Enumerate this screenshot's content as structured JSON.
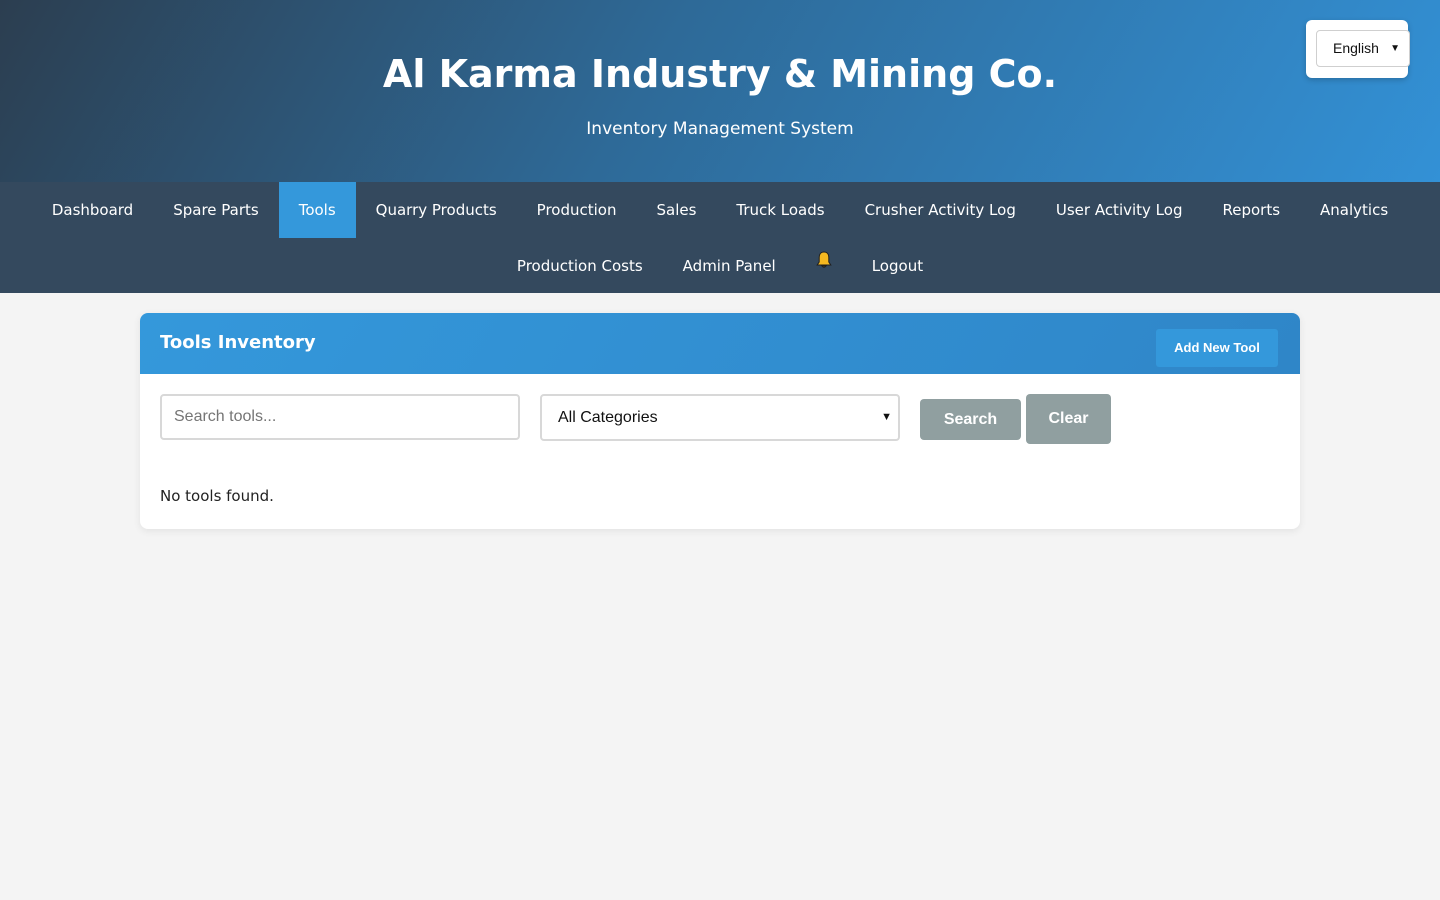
{
  "header": {
    "title": "Al Karma Industry & Mining Co.",
    "subtitle": "Inventory Management System",
    "language": {
      "selected": "English"
    }
  },
  "nav": {
    "row1": [
      {
        "label": "Dashboard",
        "active": false
      },
      {
        "label": "Spare Parts",
        "active": false
      },
      {
        "label": "Tools",
        "active": true
      },
      {
        "label": "Quarry Products",
        "active": false
      },
      {
        "label": "Production",
        "active": false
      },
      {
        "label": "Sales",
        "active": false
      },
      {
        "label": "Truck Loads",
        "active": false
      },
      {
        "label": "Crusher Activity Log",
        "active": false
      },
      {
        "label": "User Activity Log",
        "active": false
      },
      {
        "label": "Reports",
        "active": false
      },
      {
        "label": "Analytics",
        "active": false
      }
    ],
    "row2": [
      {
        "label": "Production Costs"
      },
      {
        "label": "Admin Panel"
      },
      {
        "icon": "bell-icon"
      },
      {
        "label": "Logout"
      }
    ]
  },
  "tools": {
    "title": "Tools Inventory",
    "add_label": "Add New Tool",
    "search_placeholder": "Search tools...",
    "category_selected": "All Categories",
    "search_label": "Search",
    "clear_label": "Clear",
    "empty_message": "No tools found."
  },
  "colors": {
    "nav_bg": "#34495e",
    "accent": "#3498db",
    "button_gray": "#909fa0",
    "page_bg": "#f4f4f4"
  }
}
